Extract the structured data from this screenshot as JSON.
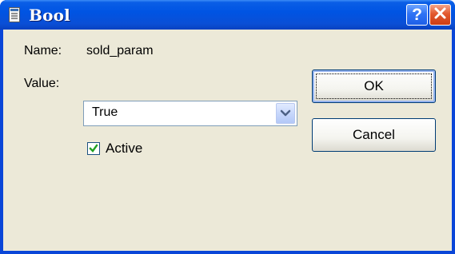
{
  "window": {
    "title": "Bool",
    "help_button": "?",
    "close_button": "close"
  },
  "form": {
    "name_label": "Name:",
    "name_value": "sold_param",
    "value_label": "Value:",
    "value_selected": "True",
    "active_label": "Active",
    "active_checked": true
  },
  "buttons": {
    "ok_label": "OK",
    "cancel_label": "Cancel"
  },
  "icons": {
    "title_icon": "document-icon",
    "help_icon": "help-icon",
    "close_icon": "close-icon",
    "dropdown_icon": "chevron-down-icon",
    "check_icon": "checkmark-icon"
  },
  "colors": {
    "titlebar": "#0054e3",
    "client_background": "#ece9d8",
    "close_button": "#e2582f",
    "checkmark": "#21a121"
  }
}
